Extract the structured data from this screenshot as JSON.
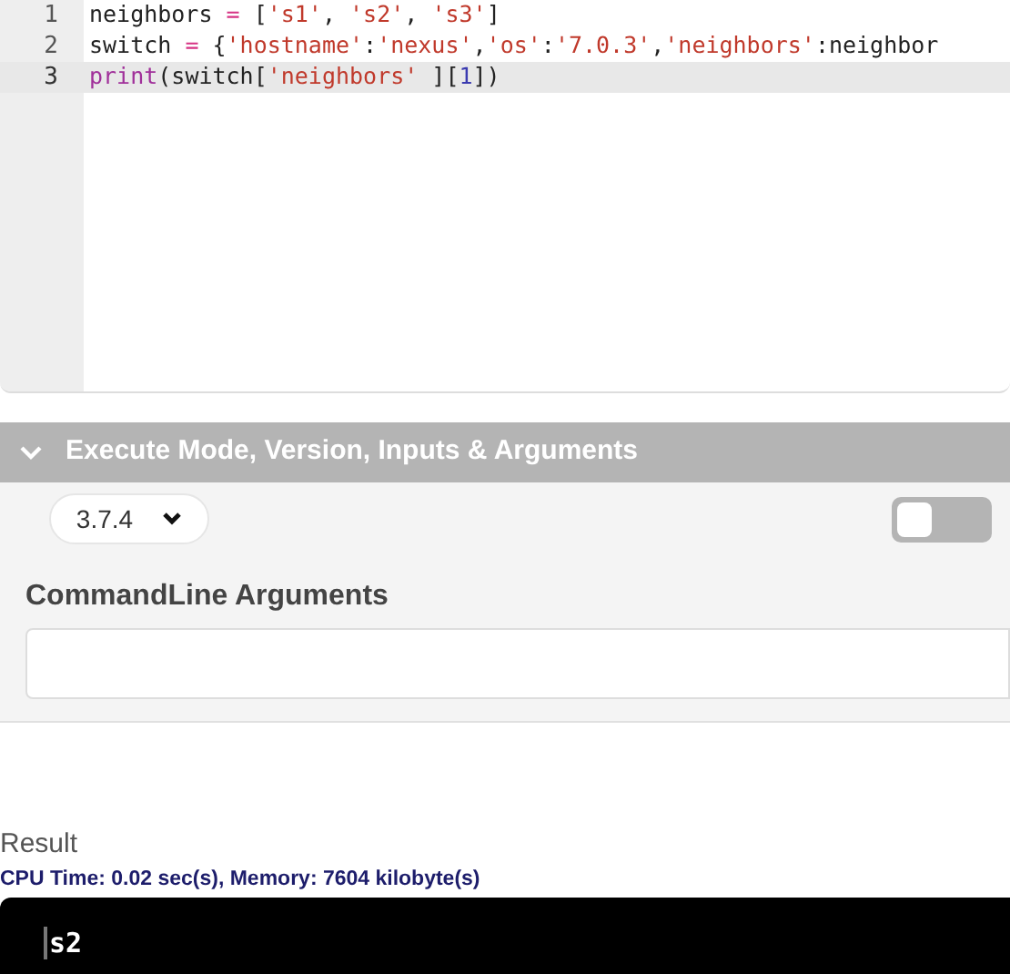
{
  "editor": {
    "lines": [
      {
        "number": "1",
        "current": false,
        "tokens": [
          {
            "kind": "plain",
            "text": "neighbors "
          },
          {
            "kind": "op",
            "text": "="
          },
          {
            "kind": "plain",
            "text": " ["
          },
          {
            "kind": "str",
            "text": "'s1'"
          },
          {
            "kind": "plain",
            "text": ", "
          },
          {
            "kind": "str",
            "text": "'s2'"
          },
          {
            "kind": "plain",
            "text": ", "
          },
          {
            "kind": "str",
            "text": "'s3'"
          },
          {
            "kind": "plain",
            "text": "]"
          }
        ]
      },
      {
        "number": "2",
        "current": false,
        "tokens": [
          {
            "kind": "plain",
            "text": "switch "
          },
          {
            "kind": "op",
            "text": "="
          },
          {
            "kind": "plain",
            "text": " {"
          },
          {
            "kind": "str",
            "text": "'hostname'"
          },
          {
            "kind": "plain",
            "text": ":"
          },
          {
            "kind": "str",
            "text": "'nexus'"
          },
          {
            "kind": "plain",
            "text": ","
          },
          {
            "kind": "str",
            "text": "'os'"
          },
          {
            "kind": "plain",
            "text": ":"
          },
          {
            "kind": "str",
            "text": "'7.0.3'"
          },
          {
            "kind": "plain",
            "text": ","
          },
          {
            "kind": "str",
            "text": "'neighbors'"
          },
          {
            "kind": "plain",
            "text": ":neighbor"
          }
        ]
      },
      {
        "number": "3",
        "current": true,
        "tokens": [
          {
            "kind": "builtin",
            "text": "print"
          },
          {
            "kind": "plain",
            "text": "(switch["
          },
          {
            "kind": "str",
            "text": "'neighbors'"
          },
          {
            "kind": "plain",
            "text": " ]["
          },
          {
            "kind": "num",
            "text": "1"
          },
          {
            "kind": "plain",
            "text": "])"
          }
        ]
      }
    ]
  },
  "execute_panel": {
    "title": "Execute Mode, Version, Inputs & Arguments",
    "expanded": true,
    "version": "3.7.4",
    "toggle": {
      "on": false
    },
    "arguments_label": "CommandLine Arguments"
  },
  "result": {
    "title": "Result",
    "stats": "CPU Time: 0.02 sec(s), Memory: 7604 kilobyte(s)",
    "output": "s2"
  }
}
